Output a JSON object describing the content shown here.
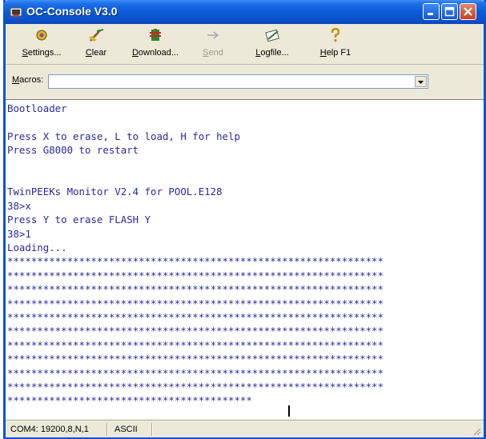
{
  "window": {
    "title": "OC-Console V3.0"
  },
  "toolbar": {
    "items": [
      {
        "accel": "S",
        "rest": "ettings...",
        "icon": "settings-icon",
        "enabled": true
      },
      {
        "accel": "C",
        "rest": "lear",
        "icon": "clear-icon",
        "enabled": true
      },
      {
        "accel": "D",
        "rest": "ownload...",
        "icon": "download-icon",
        "enabled": true
      },
      {
        "accel": "S",
        "rest": "end",
        "icon": "send-icon",
        "enabled": false
      },
      {
        "accel": "L",
        "rest": "ogfile...",
        "icon": "logfile-icon",
        "enabled": true
      },
      {
        "accel": "H",
        "rest": "elp F1",
        "icon": "help-icon",
        "enabled": true
      }
    ]
  },
  "macros": {
    "accel": "M",
    "rest": "acros:",
    "value": ""
  },
  "console": {
    "lines": [
      "Bootloader",
      "",
      "Press X to erase, L to load, H for help",
      "Press G8000 to restart",
      "",
      "",
      "TwinPEEKs Monitor V2.4 for POOL.E128",
      "38>x",
      "Press Y to erase FLASH Y",
      "38>1",
      "Loading...",
      "***************************************************************",
      "***************************************************************",
      "***************************************************************",
      "***************************************************************",
      "***************************************************************",
      "***************************************************************",
      "***************************************************************",
      "***************************************************************",
      "***************************************************************",
      "***************************************************************",
      "*****************************************"
    ]
  },
  "status": {
    "port": "COM4: 19200,8,N,1",
    "mode": "ASCII"
  },
  "colors": {
    "titlebar": "#0A50C8",
    "console_text": "#2A2A9E",
    "face": "#ECE9D8"
  }
}
